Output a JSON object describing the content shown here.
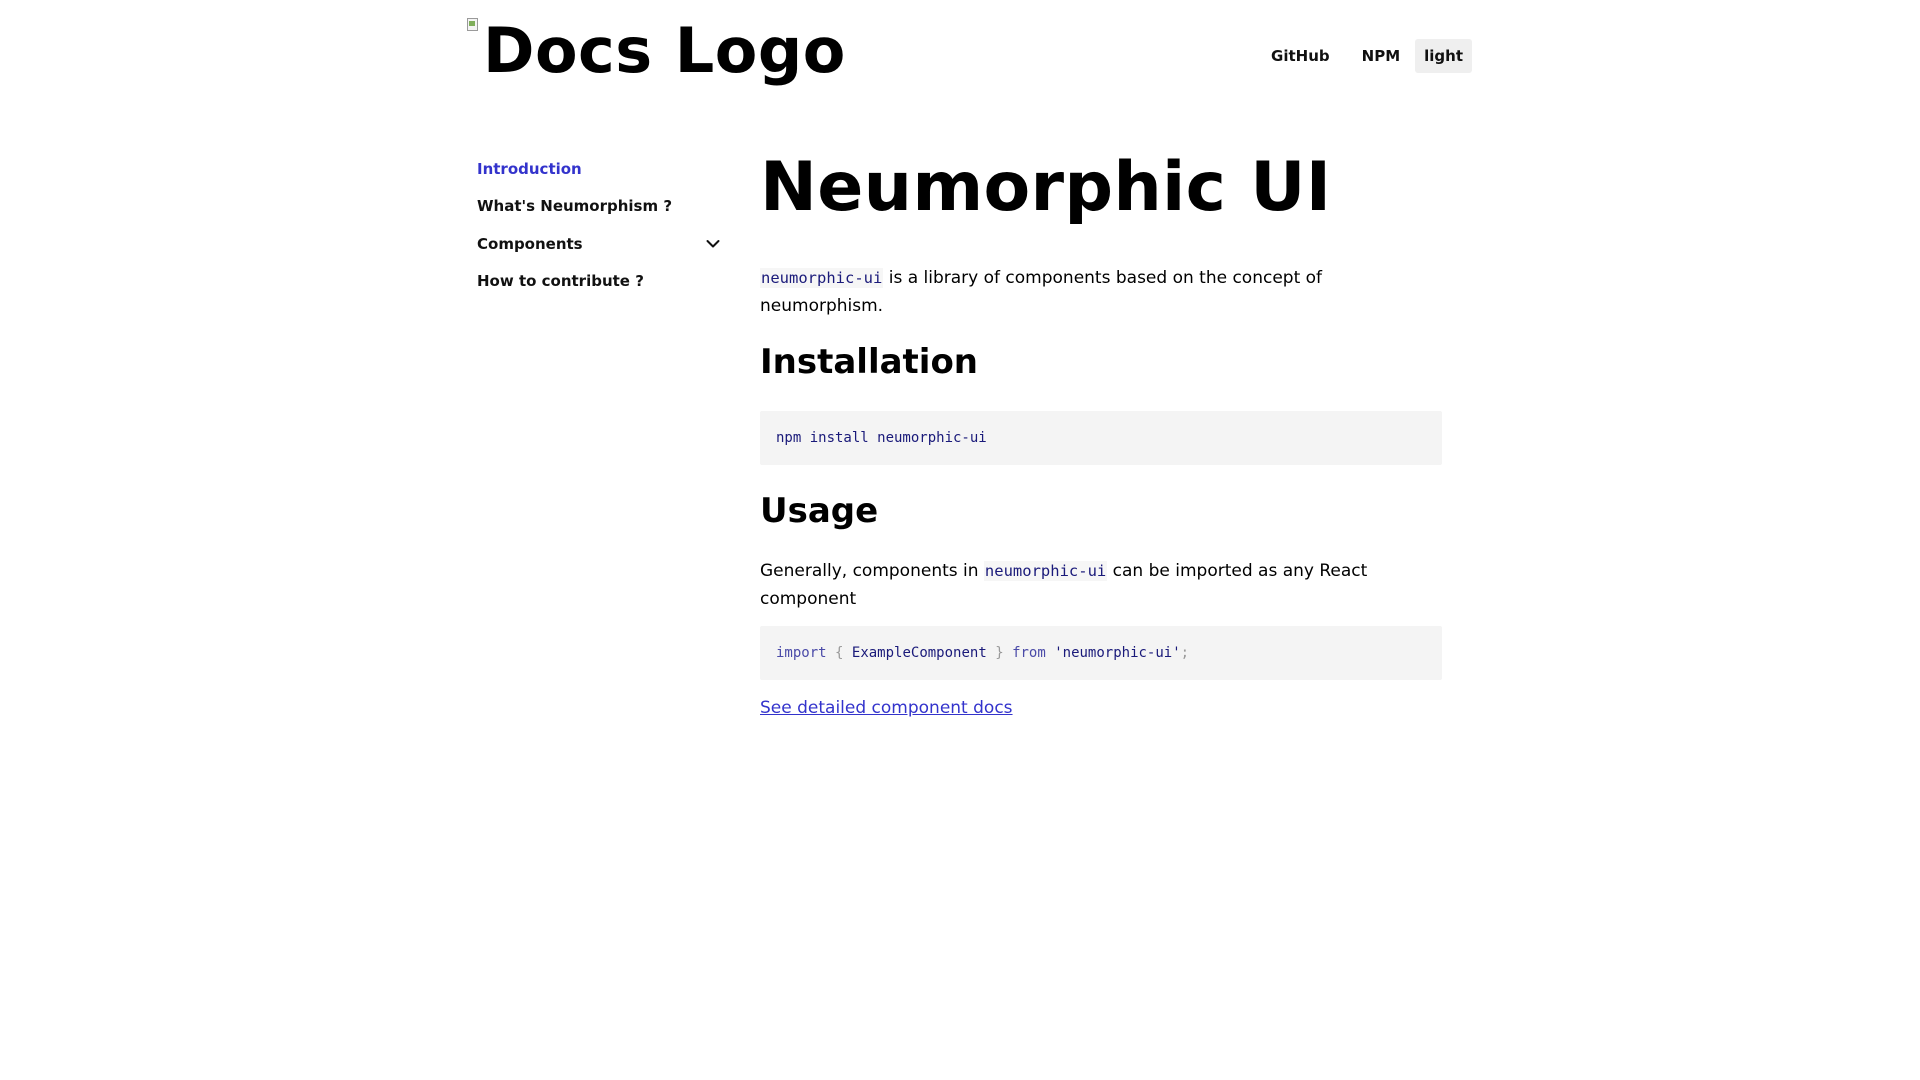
{
  "header": {
    "logo_text": "Docs Logo",
    "nav": [
      {
        "label": "GitHub"
      },
      {
        "label": "NPM"
      }
    ],
    "theme_toggle_label": "light"
  },
  "sidebar": {
    "items": [
      {
        "label": "Introduction",
        "active": true
      },
      {
        "label": "What's Neumorphism ?"
      },
      {
        "label": "Components",
        "icon": "chevron-down-icon"
      },
      {
        "label": "How to contribute ?"
      }
    ]
  },
  "main": {
    "title": "Neumorphic UI",
    "intro": {
      "code": "neumorphic-ui",
      "text": " is a library of components based on the concept of neumorphism."
    },
    "installation": {
      "heading": "Installation",
      "command": "npm install neumorphic-ui"
    },
    "usage": {
      "heading": "Usage",
      "text_before": "Generally, components in ",
      "code": "neumorphic-ui",
      "text_after": " can be imported as any React component",
      "import_code": {
        "kw_import": "import",
        "brace_open": "{",
        "component": "ExampleComponent",
        "brace_close": "}",
        "kw_from": "from",
        "module": "'neumorphic-ui'",
        "semicolon": ";"
      }
    },
    "docs_link": "See detailed component docs"
  },
  "colors": {
    "accent": "#3333cc",
    "code_text": "#1a1a7a",
    "code_bg": "#f4f4f4"
  }
}
